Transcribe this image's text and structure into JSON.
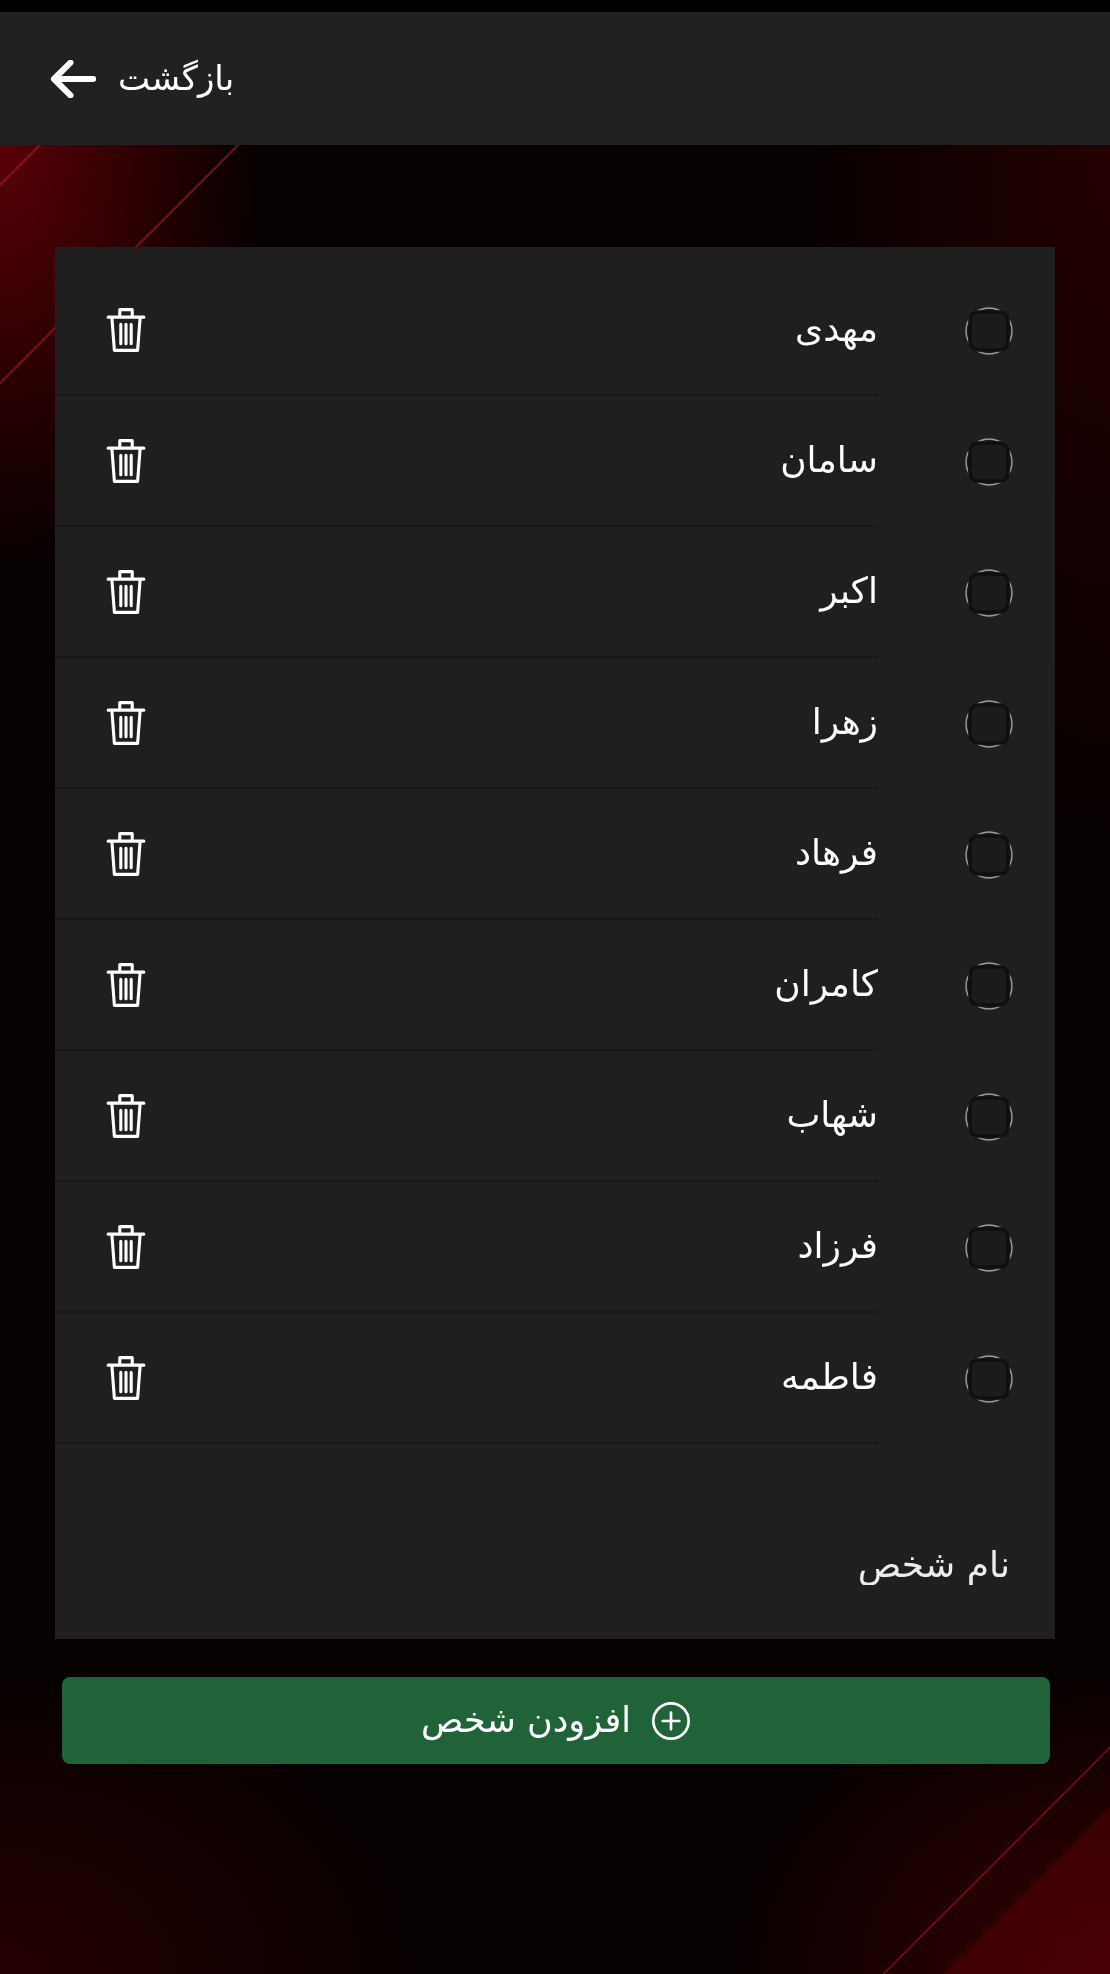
{
  "header": {
    "back_label": "بازگشت"
  },
  "people": [
    {
      "name": "مهدی",
      "checked": false
    },
    {
      "name": "سامان",
      "checked": false
    },
    {
      "name": "اکبر",
      "checked": false
    },
    {
      "name": "زهرا",
      "checked": false
    },
    {
      "name": "فرهاد",
      "checked": false
    },
    {
      "name": "کامران",
      "checked": false
    },
    {
      "name": "شهاب",
      "checked": false
    },
    {
      "name": "فرزاد",
      "checked": false
    },
    {
      "name": "فاطمه",
      "checked": false
    }
  ],
  "name_field": {
    "placeholder": "نام شخص"
  },
  "add_button": {
    "label": "افزودن شخص"
  }
}
